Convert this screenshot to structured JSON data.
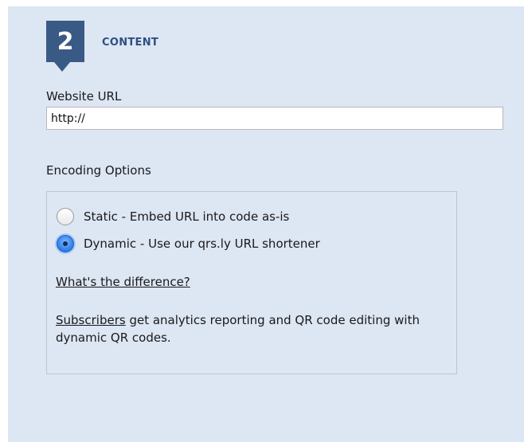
{
  "step": {
    "number": "2",
    "title": "CONTENT"
  },
  "url_field": {
    "label": "Website URL",
    "value": "http://"
  },
  "encoding": {
    "heading": "Encoding Options",
    "options": [
      {
        "label": "Static - Embed URL into code as-is",
        "selected": false
      },
      {
        "label": "Dynamic - Use our qrs.ly URL shortener",
        "selected": true
      }
    ],
    "difference_link": "What's the difference?",
    "subscribers_link": "Subscribers",
    "subscribers_text": " get analytics reporting and QR code editing with dynamic QR codes."
  },
  "colors": {
    "panel_bg": "#dde6f3",
    "badge_bg": "#3a5a86",
    "title_color": "#2e4f7f",
    "radio_selected": "#2a7be6"
  }
}
